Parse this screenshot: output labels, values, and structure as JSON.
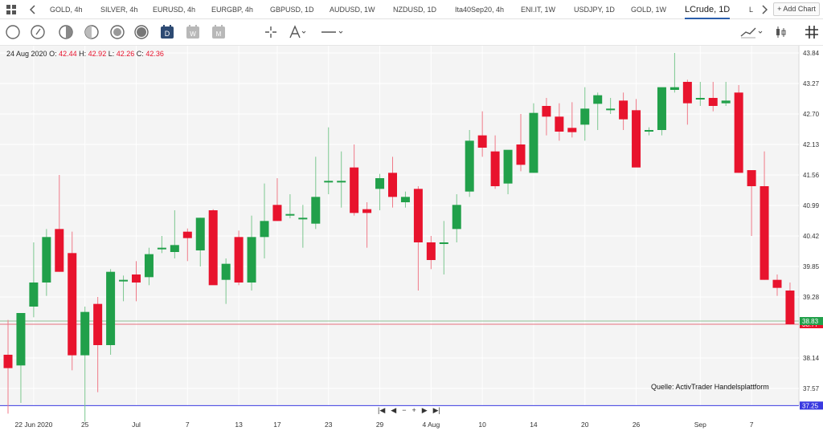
{
  "tabs": [
    {
      "label": "GOLD, 4h",
      "active": false
    },
    {
      "label": "SILVER, 4h",
      "active": false
    },
    {
      "label": "EURUSD, 4h",
      "active": false
    },
    {
      "label": "EURGBP, 4h",
      "active": false
    },
    {
      "label": "GBPUSD, 1D",
      "active": false
    },
    {
      "label": "AUDUSD, 1W",
      "active": false
    },
    {
      "label": "NZDUSD, 1D",
      "active": false
    },
    {
      "label": "Ita40Sep20, 4h",
      "active": false
    },
    {
      "label": "ENI.IT, 1W",
      "active": false
    },
    {
      "label": "USDJPY, 1D",
      "active": false
    },
    {
      "label": "GOLD, 1W",
      "active": false
    },
    {
      "label": "LCrude, 1D",
      "active": true
    },
    {
      "label": "L",
      "active": false
    }
  ],
  "add_chart_label": "+ Add Chart",
  "toolbar_icons": [
    "circle-tool-icon",
    "circle-arrow-tool-icon",
    "half-circle-tool-icon",
    "ellipse-tool-icon",
    "filled-circle-tool-icon",
    "daily-calendar-icon",
    "weekly-calendar-icon",
    "monthly-calendar-icon",
    "crosshair-icon",
    "drawing-pen-icon",
    "line-style-icon",
    "trend-chart-icon",
    "candle-style-icon",
    "grid-icon"
  ],
  "calendar_letters": {
    "daily": "D",
    "weekly": "W",
    "monthly": "M"
  },
  "ohlc": {
    "date": "24 Aug 2020",
    "o_label": "O:",
    "o": "42.44",
    "h_label": "H:",
    "h": "42.92",
    "l_label": "L:",
    "l": "42.26",
    "c_label": "C:",
    "c": "42.36"
  },
  "source_label": "Quelle: ActivTrader Handelsplattform",
  "nav_buttons": [
    "|◀",
    "◀",
    "−",
    "+",
    "▶",
    "▶|"
  ],
  "chart_data": {
    "type": "candlestick",
    "y_ticks": [
      "43.84",
      "43.27",
      "42.70",
      "42.13",
      "41.56",
      "40.99",
      "40.42",
      "39.85",
      "39.28",
      "38.14",
      "37.57"
    ],
    "x_ticks": [
      "22 Jun 2020",
      "25",
      "Jul",
      "7",
      "13",
      "17",
      "23",
      "29",
      "4 Aug",
      "10",
      "14",
      "20",
      "26",
      "Sep",
      "7"
    ],
    "current_price_labels": [
      "38.83",
      "38.77"
    ],
    "horizontal_line_label": "37.25",
    "colors": {
      "up": "#21a04a",
      "down": "#e8132d",
      "wick": "#7bc78f",
      "grid": "#ffffff",
      "hline": "#3a3ae0",
      "price_green": "#21a04a",
      "price_red": "#e8132d"
    },
    "y_range": [
      37.25,
      43.84
    ],
    "candles": [
      {
        "o": 38.2,
        "h": 38.85,
        "l": 37.1,
        "c": 37.95
      },
      {
        "o": 38.0,
        "h": 38.98,
        "l": 37.3,
        "c": 38.98
      },
      {
        "o": 39.1,
        "h": 40.3,
        "l": 38.9,
        "c": 39.55
      },
      {
        "o": 39.55,
        "h": 40.55,
        "l": 39.3,
        "c": 40.4
      },
      {
        "o": 40.55,
        "h": 41.56,
        "l": 39.75,
        "c": 39.75
      },
      {
        "o": 40.1,
        "h": 40.5,
        "l": 37.91,
        "c": 38.19
      },
      {
        "o": 38.19,
        "h": 39.1,
        "l": 36.95,
        "c": 39.0
      },
      {
        "o": 39.15,
        "h": 39.28,
        "l": 37.5,
        "c": 38.38
      },
      {
        "o": 38.38,
        "h": 39.8,
        "l": 38.2,
        "c": 39.75
      },
      {
        "o": 39.6,
        "h": 39.68,
        "l": 39.2,
        "c": 39.6
      },
      {
        "o": 39.7,
        "h": 39.95,
        "l": 39.2,
        "c": 39.55
      },
      {
        "o": 39.65,
        "h": 40.2,
        "l": 39.5,
        "c": 40.08
      },
      {
        "o": 40.2,
        "h": 40.42,
        "l": 40.1,
        "c": 40.2
      },
      {
        "o": 40.12,
        "h": 40.9,
        "l": 40.0,
        "c": 40.25
      },
      {
        "o": 40.5,
        "h": 40.56,
        "l": 39.95,
        "c": 40.38
      },
      {
        "o": 40.15,
        "h": 40.76,
        "l": 39.85,
        "c": 40.76
      },
      {
        "o": 40.9,
        "h": 40.92,
        "l": 39.6,
        "c": 39.5
      },
      {
        "o": 39.6,
        "h": 40.0,
        "l": 39.15,
        "c": 39.9
      },
      {
        "o": 40.4,
        "h": 40.52,
        "l": 39.5,
        "c": 39.55
      },
      {
        "o": 39.55,
        "h": 40.8,
        "l": 39.4,
        "c": 40.4
      },
      {
        "o": 40.4,
        "h": 41.4,
        "l": 40.0,
        "c": 40.7
      },
      {
        "o": 41.0,
        "h": 41.5,
        "l": 40.7,
        "c": 40.7
      },
      {
        "o": 40.8,
        "h": 41.2,
        "l": 40.75,
        "c": 40.83
      },
      {
        "o": 40.76,
        "h": 41.0,
        "l": 40.2,
        "c": 40.76
      },
      {
        "o": 40.65,
        "h": 41.9,
        "l": 40.55,
        "c": 41.15
      },
      {
        "o": 41.45,
        "h": 42.45,
        "l": 41.2,
        "c": 41.45
      },
      {
        "o": 41.45,
        "h": 42.0,
        "l": 40.95,
        "c": 41.45
      },
      {
        "o": 41.7,
        "h": 42.13,
        "l": 40.8,
        "c": 40.85
      },
      {
        "o": 40.92,
        "h": 41.05,
        "l": 40.2,
        "c": 40.85
      },
      {
        "o": 41.3,
        "h": 41.58,
        "l": 40.9,
        "c": 41.5
      },
      {
        "o": 41.6,
        "h": 41.9,
        "l": 40.95,
        "c": 41.15
      },
      {
        "o": 41.05,
        "h": 41.25,
        "l": 40.95,
        "c": 41.15
      },
      {
        "o": 41.3,
        "h": 41.35,
        "l": 39.4,
        "c": 40.3
      },
      {
        "o": 40.3,
        "h": 40.42,
        "l": 39.8,
        "c": 39.97
      },
      {
        "o": 40.3,
        "h": 40.7,
        "l": 39.7,
        "c": 40.3
      },
      {
        "o": 40.55,
        "h": 41.2,
        "l": 40.3,
        "c": 41.0
      },
      {
        "o": 41.25,
        "h": 42.4,
        "l": 41.15,
        "c": 42.2
      },
      {
        "o": 42.3,
        "h": 42.75,
        "l": 41.9,
        "c": 42.07
      },
      {
        "o": 42.0,
        "h": 42.3,
        "l": 41.3,
        "c": 41.35
      },
      {
        "o": 41.4,
        "h": 42.0,
        "l": 41.2,
        "c": 42.03
      },
      {
        "o": 42.13,
        "h": 42.7,
        "l": 41.63,
        "c": 41.75
      },
      {
        "o": 41.6,
        "h": 42.9,
        "l": 41.6,
        "c": 42.72
      },
      {
        "o": 42.85,
        "h": 43.0,
        "l": 42.3,
        "c": 42.65
      },
      {
        "o": 42.65,
        "h": 42.9,
        "l": 42.2,
        "c": 42.37
      },
      {
        "o": 42.44,
        "h": 42.92,
        "l": 42.26,
        "c": 42.36
      },
      {
        "o": 42.5,
        "h": 43.2,
        "l": 42.2,
        "c": 42.8
      },
      {
        "o": 42.89,
        "h": 43.1,
        "l": 42.4,
        "c": 43.05
      },
      {
        "o": 42.8,
        "h": 43.0,
        "l": 42.7,
        "c": 42.8
      },
      {
        "o": 42.95,
        "h": 43.1,
        "l": 42.4,
        "c": 42.6
      },
      {
        "o": 42.77,
        "h": 42.98,
        "l": 41.8,
        "c": 41.7
      },
      {
        "o": 42.4,
        "h": 42.45,
        "l": 42.3,
        "c": 42.4
      },
      {
        "o": 42.4,
        "h": 42.9,
        "l": 42.3,
        "c": 43.2
      },
      {
        "o": 43.15,
        "h": 43.84,
        "l": 43.1,
        "c": 43.2
      },
      {
        "o": 43.3,
        "h": 43.34,
        "l": 42.5,
        "c": 42.9
      },
      {
        "o": 43.0,
        "h": 43.3,
        "l": 42.85,
        "c": 43.0
      },
      {
        "o": 43.0,
        "h": 43.3,
        "l": 42.75,
        "c": 42.85
      },
      {
        "o": 42.9,
        "h": 43.3,
        "l": 42.85,
        "c": 42.95
      },
      {
        "o": 43.1,
        "h": 43.24,
        "l": 41.6,
        "c": 41.6
      },
      {
        "o": 41.65,
        "h": 41.65,
        "l": 40.42,
        "c": 41.35
      },
      {
        "o": 41.35,
        "h": 42.0,
        "l": 39.6,
        "c": 39.6
      },
      {
        "o": 39.6,
        "h": 39.7,
        "l": 39.3,
        "c": 39.45
      },
      {
        "o": 39.4,
        "h": 39.55,
        "l": 38.76,
        "c": 38.77
      }
    ]
  }
}
